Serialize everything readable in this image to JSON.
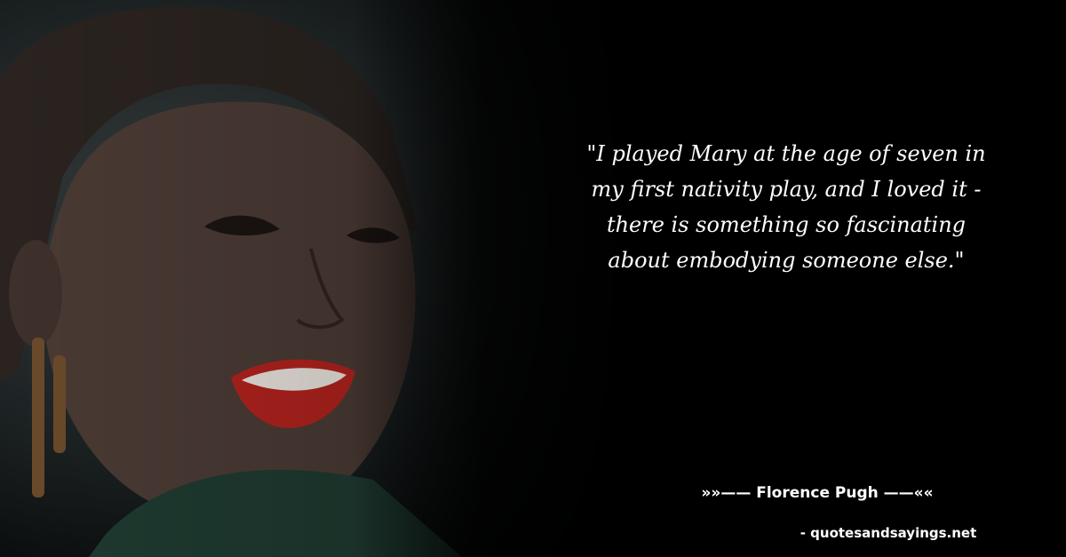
{
  "quote": {
    "text": "\"I played Mary at the age of seven in my first nativity play, and I loved it - there is something so fascinating about embodying someone else.\""
  },
  "author": {
    "line": "»»—— Florence Pugh ——««"
  },
  "source": {
    "site": "- quotesandsayings.net"
  },
  "colors": {
    "background": "#000000",
    "text": "#ffffff",
    "lips": "#b0221d"
  }
}
